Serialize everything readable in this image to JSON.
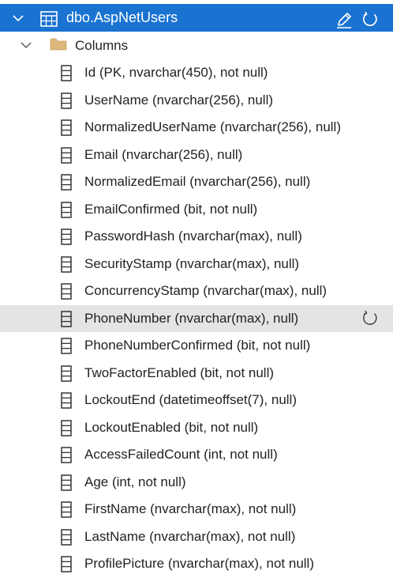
{
  "table": {
    "name": "dbo.AspNetUsers",
    "icon": "table-icon"
  },
  "folder": {
    "label": "Columns",
    "icon": "folder-icon"
  },
  "columns": [
    "Id (PK, nvarchar(450), not null)",
    "UserName (nvarchar(256), null)",
    "NormalizedUserName (nvarchar(256), null)",
    "Email (nvarchar(256), null)",
    "NormalizedEmail (nvarchar(256), null)",
    "EmailConfirmed (bit, not null)",
    "PasswordHash (nvarchar(max), null)",
    "SecurityStamp (nvarchar(max), null)",
    "ConcurrencyStamp (nvarchar(max), null)",
    "PhoneNumber (nvarchar(max), null)",
    "PhoneNumberConfirmed (bit, not null)",
    "TwoFactorEnabled (bit, not null)",
    "LockoutEnd (datetimeoffset(7), null)",
    "LockoutEnabled (bit, not null)",
    "AccessFailedCount (int, not null)",
    "Age (int, not null)",
    "FirstName (nvarchar(max), not null)",
    "LastName (nvarchar(max), not null)",
    "ProfilePicture (nvarchar(max), not null)"
  ],
  "hovered_column_index": 9,
  "colors": {
    "selected_background": "#1a73d1",
    "hover_background": "#e4e4e4",
    "folder_color": "#dcb67a"
  }
}
